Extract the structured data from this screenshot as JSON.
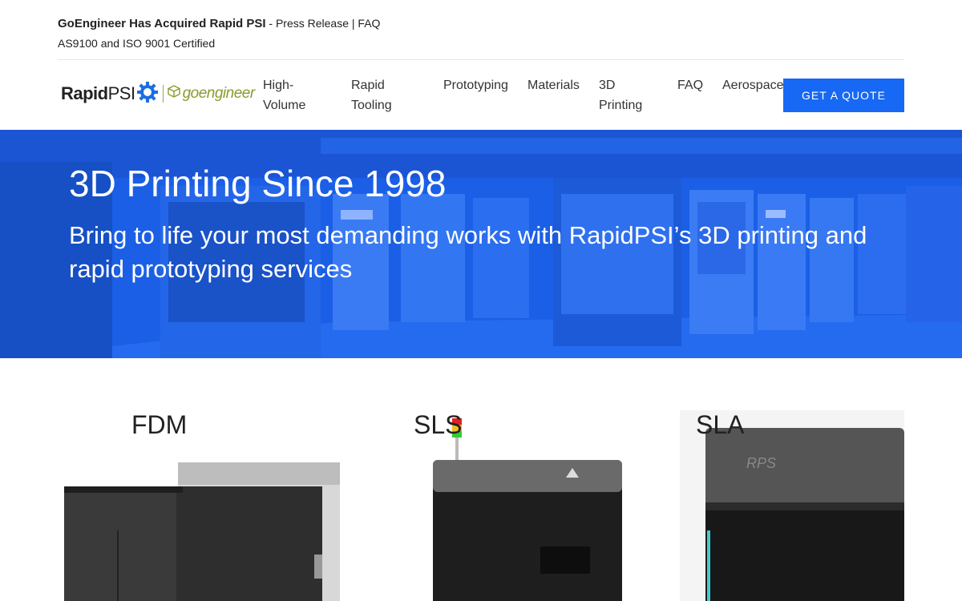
{
  "announcement": {
    "headline": "GoEngineer Has Acquired Rapid PSI",
    "separator": "-",
    "press_release": "Press Release",
    "pipe": "|",
    "faq": "FAQ",
    "certification": "AS9100 and ISO 9001 Certified"
  },
  "logo": {
    "rapid": "Rapid",
    "psi": "PSI",
    "partner": "goengineer"
  },
  "nav": {
    "items": [
      {
        "label_line1": "High-",
        "label_line2": "Volume"
      },
      {
        "label_line1": "Rapid",
        "label_line2": "Tooling"
      },
      {
        "label_line1": "Prototyping",
        "label_line2": ""
      },
      {
        "label_line1": "Materials",
        "label_line2": ""
      },
      {
        "label_line1": "3D",
        "label_line2": "Printing"
      },
      {
        "label_line1": "FAQ",
        "label_line2": ""
      },
      {
        "label_line1": "Aerospace",
        "label_line2": ""
      }
    ],
    "cta": "GET A QUOTE"
  },
  "hero": {
    "title": "3D Printing Since 1998",
    "subtitle": "Bring to life your most demanding works with RapidPSI’s 3D printing and rapid prototyping services"
  },
  "cards": [
    {
      "title": "FDM"
    },
    {
      "title": "SLS"
    },
    {
      "title": "SLA"
    }
  ],
  "colors": {
    "accent": "#1668f5",
    "hero_overlay": "#1a5de8",
    "partner_green": "#8a9a2c"
  },
  "icons": {
    "logo_gear": "gear-icon",
    "partner_cube": "cube-icon"
  }
}
